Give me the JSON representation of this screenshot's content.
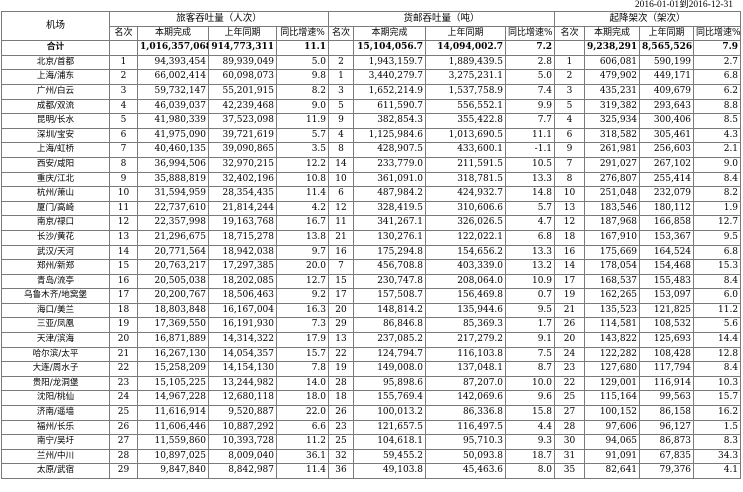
{
  "date_range": "2016-01-01到2016-12-31",
  "headers": {
    "airport": "机场",
    "passenger": "旅客吞吐量（人次）",
    "cargo": "货邮吞吐量（吨）",
    "movement": "起降架次（架次）",
    "rank": "名次",
    "current": "本期完成",
    "previous": "上年同期",
    "growth": "同比增速%"
  },
  "total": {
    "name": "合计",
    "p_cur": "1,016,357,068",
    "p_prev": "914,773,311",
    "p_gr": "11.1",
    "c_cur": "15,104,056.7",
    "c_prev": "14,094,002.7",
    "c_gr": "7.2",
    "m_cur": "9,238,291",
    "m_prev": "8,565,526",
    "m_gr": "7.9"
  },
  "rows": [
    {
      "name": "北京/首都",
      "pr": "1",
      "pc": "94,393,454",
      "pp": "89,939,049",
      "pg": "5.0",
      "cr": "2",
      "cc": "1,943,159.7",
      "cp": "1,889,439.5",
      "cg": "2.8",
      "mr": "1",
      "mc": "606,081",
      "mp": "590,199",
      "mg": "2.7"
    },
    {
      "name": "上海/浦东",
      "pr": "2",
      "pc": "66,002,414",
      "pp": "60,098,073",
      "pg": "9.8",
      "cr": "1",
      "cc": "3,440,279.7",
      "cp": "3,275,231.1",
      "cg": "5.0",
      "mr": "2",
      "mc": "479,902",
      "mp": "449,171",
      "mg": "6.8"
    },
    {
      "name": "广州/白云",
      "pr": "3",
      "pc": "59,732,147",
      "pp": "55,201,915",
      "pg": "8.2",
      "cr": "3",
      "cc": "1,652,214.9",
      "cp": "1,537,758.9",
      "cg": "7.4",
      "mr": "3",
      "mc": "435,231",
      "mp": "409,679",
      "mg": "6.2"
    },
    {
      "name": "成都/双流",
      "pr": "4",
      "pc": "46,039,037",
      "pp": "42,239,468",
      "pg": "9.0",
      "cr": "5",
      "cc": "611,590.7",
      "cp": "556,552.1",
      "cg": "9.9",
      "mr": "5",
      "mc": "319,382",
      "mp": "293,643",
      "mg": "8.8"
    },
    {
      "name": "昆明/长水",
      "pr": "5",
      "pc": "41,980,339",
      "pp": "37,523,098",
      "pg": "11.9",
      "cr": "9",
      "cc": "382,854.3",
      "cp": "355,422.8",
      "cg": "7.7",
      "mr": "4",
      "mc": "325,934",
      "mp": "300,406",
      "mg": "8.5"
    },
    {
      "name": "深圳/宝安",
      "pr": "6",
      "pc": "41,975,090",
      "pp": "39,721,619",
      "pg": "5.7",
      "cr": "4",
      "cc": "1,125,984.6",
      "cp": "1,013,690.5",
      "cg": "11.1",
      "mr": "6",
      "mc": "318,582",
      "mp": "305,461",
      "mg": "4.3"
    },
    {
      "name": "上海/虹桥",
      "pr": "7",
      "pc": "40,460,135",
      "pp": "39,090,865",
      "pg": "3.5",
      "cr": "8",
      "cc": "428,907.5",
      "cp": "433,600.1",
      "cg": "-1.1",
      "mr": "9",
      "mc": "261,981",
      "mp": "256,603",
      "mg": "2.1"
    },
    {
      "name": "西安/咸阳",
      "pr": "8",
      "pc": "36,994,506",
      "pp": "32,970,215",
      "pg": "12.2",
      "cr": "14",
      "cc": "233,779.0",
      "cp": "211,591.5",
      "cg": "10.5",
      "mr": "7",
      "mc": "291,027",
      "mp": "267,102",
      "mg": "9.0"
    },
    {
      "name": "重庆/江北",
      "pr": "9",
      "pc": "35,888,819",
      "pp": "32,402,196",
      "pg": "10.8",
      "cr": "10",
      "cc": "361,091.0",
      "cp": "318,781.5",
      "cg": "13.3",
      "mr": "8",
      "mc": "276,807",
      "mp": "255,414",
      "mg": "8.4"
    },
    {
      "name": "杭州/萧山",
      "pr": "10",
      "pc": "31,594,959",
      "pp": "28,354,435",
      "pg": "11.4",
      "cr": "6",
      "cc": "487,984.2",
      "cp": "424,932.7",
      "cg": "14.8",
      "mr": "10",
      "mc": "251,048",
      "mp": "232,079",
      "mg": "8.2"
    },
    {
      "name": "厦门/高崎",
      "pr": "11",
      "pc": "22,737,610",
      "pp": "21,814,244",
      "pg": "4.2",
      "cr": "12",
      "cc": "328,419.5",
      "cp": "310,606.6",
      "cg": "5.7",
      "mr": "13",
      "mc": "183,546",
      "mp": "180,112",
      "mg": "1.9"
    },
    {
      "name": "南京/禄口",
      "pr": "12",
      "pc": "22,357,998",
      "pp": "19,163,768",
      "pg": "16.7",
      "cr": "11",
      "cc": "341,267.1",
      "cp": "326,026.5",
      "cg": "4.7",
      "mr": "12",
      "mc": "187,968",
      "mp": "166,858",
      "mg": "12.7"
    },
    {
      "name": "长沙/黄花",
      "pr": "13",
      "pc": "21,296,675",
      "pp": "18,715,278",
      "pg": "13.8",
      "cr": "21",
      "cc": "130,276.1",
      "cp": "122,022.1",
      "cg": "6.8",
      "mr": "18",
      "mc": "167,910",
      "mp": "153,367",
      "mg": "9.5"
    },
    {
      "name": "武汉/天河",
      "pr": "14",
      "pc": "20,771,564",
      "pp": "18,942,038",
      "pg": "9.7",
      "cr": "16",
      "cc": "175,294.8",
      "cp": "154,656.2",
      "cg": "13.3",
      "mr": "16",
      "mc": "175,669",
      "mp": "164,524",
      "mg": "6.8"
    },
    {
      "name": "郑州/新郑",
      "pr": "15",
      "pc": "20,763,217",
      "pp": "17,297,385",
      "pg": "20.0",
      "cr": "7",
      "cc": "456,708.8",
      "cp": "403,339.0",
      "cg": "13.2",
      "mr": "14",
      "mc": "178,054",
      "mp": "154,468",
      "mg": "15.3"
    },
    {
      "name": "青岛/流亭",
      "pr": "16",
      "pc": "20,505,038",
      "pp": "18,202,085",
      "pg": "12.7",
      "cr": "15",
      "cc": "230,747.8",
      "cp": "208,064.0",
      "cg": "10.9",
      "mr": "17",
      "mc": "168,537",
      "mp": "155,483",
      "mg": "8.4"
    },
    {
      "name": "乌鲁木齐/地窝堡",
      "pr": "17",
      "pc": "20,200,767",
      "pp": "18,506,463",
      "pg": "9.2",
      "cr": "17",
      "cc": "157,508.7",
      "cp": "156,469.8",
      "cg": "0.7",
      "mr": "19",
      "mc": "162,265",
      "mp": "153,097",
      "mg": "6.0"
    },
    {
      "name": "海口/美兰",
      "pr": "18",
      "pc": "18,803,848",
      "pp": "16,167,004",
      "pg": "16.3",
      "cr": "20",
      "cc": "148,814.2",
      "cp": "135,944.6",
      "cg": "9.5",
      "mr": "21",
      "mc": "135,523",
      "mp": "121,825",
      "mg": "11.2"
    },
    {
      "name": "三亚/凤凰",
      "pr": "19",
      "pc": "17,369,550",
      "pp": "16,191,930",
      "pg": "7.3",
      "cr": "29",
      "cc": "86,846.8",
      "cp": "85,369.3",
      "cg": "1.7",
      "mr": "26",
      "mc": "114,581",
      "mp": "108,532",
      "mg": "5.6"
    },
    {
      "name": "天津/滨海",
      "pr": "20",
      "pc": "16,871,889",
      "pp": "14,314,322",
      "pg": "17.9",
      "cr": "13",
      "cc": "237,085.2",
      "cp": "217,279.2",
      "cg": "9.1",
      "mr": "20",
      "mc": "143,822",
      "mp": "125,693",
      "mg": "14.4"
    },
    {
      "name": "哈尔滨/太平",
      "pr": "21",
      "pc": "16,267,130",
      "pp": "14,054,357",
      "pg": "15.7",
      "cr": "22",
      "cc": "124,794.7",
      "cp": "116,103.8",
      "cg": "7.5",
      "mr": "24",
      "mc": "122,282",
      "mp": "108,428",
      "mg": "12.8"
    },
    {
      "name": "大连/周水子",
      "pr": "22",
      "pc": "15,258,209",
      "pp": "14,154,130",
      "pg": "7.8",
      "cr": "19",
      "cc": "149,008.0",
      "cp": "137,048.1",
      "cg": "8.7",
      "mr": "23",
      "mc": "127,680",
      "mp": "117,794",
      "mg": "8.4"
    },
    {
      "name": "贵阳/龙洞堡",
      "pr": "23",
      "pc": "15,105,225",
      "pp": "13,244,982",
      "pg": "14.0",
      "cr": "28",
      "cc": "95,898.6",
      "cp": "87,207.0",
      "cg": "10.0",
      "mr": "22",
      "mc": "129,001",
      "mp": "116,914",
      "mg": "10.3"
    },
    {
      "name": "沈阳/桃仙",
      "pr": "24",
      "pc": "14,967,228",
      "pp": "12,680,118",
      "pg": "18.0",
      "cr": "18",
      "cc": "155,769.4",
      "cp": "142,069.6",
      "cg": "9.6",
      "mr": "25",
      "mc": "115,164",
      "mp": "99,563",
      "mg": "15.7"
    },
    {
      "name": "济南/遥墙",
      "pr": "25",
      "pc": "11,616,914",
      "pp": "9,520,887",
      "pg": "22.0",
      "cr": "26",
      "cc": "100,013.2",
      "cp": "86,336.8",
      "cg": "15.8",
      "mr": "27",
      "mc": "100,152",
      "mp": "86,158",
      "mg": "16.2"
    },
    {
      "name": "福州/长乐",
      "pr": "26",
      "pc": "11,606,446",
      "pp": "10,887,292",
      "pg": "6.6",
      "cr": "23",
      "cc": "121,657.5",
      "cp": "116,497.5",
      "cg": "4.4",
      "mr": "28",
      "mc": "97,606",
      "mp": "96,127",
      "mg": "1.5"
    },
    {
      "name": "南宁/吴圩",
      "pr": "27",
      "pc": "11,559,860",
      "pp": "10,393,728",
      "pg": "11.2",
      "cr": "25",
      "cc": "104,618.1",
      "cp": "95,710.3",
      "cg": "9.3",
      "mr": "30",
      "mc": "94,065",
      "mp": "86,873",
      "mg": "8.3"
    },
    {
      "name": "兰州/中川",
      "pr": "28",
      "pc": "10,897,025",
      "pp": "8,009,040",
      "pg": "36.1",
      "cr": "32",
      "cc": "59,455.2",
      "cp": "50,093.8",
      "cg": "18.7",
      "mr": "31",
      "mc": "91,091",
      "mp": "67,835",
      "mg": "34.3"
    },
    {
      "name": "太原/武宿",
      "pr": "29",
      "pc": "9,847,840",
      "pp": "8,842,987",
      "pg": "11.4",
      "cr": "36",
      "cc": "49,103.8",
      "cp": "45,463.6",
      "cg": "8.0",
      "mr": "35",
      "mc": "82,641",
      "mp": "79,376",
      "mg": "4.1"
    }
  ]
}
